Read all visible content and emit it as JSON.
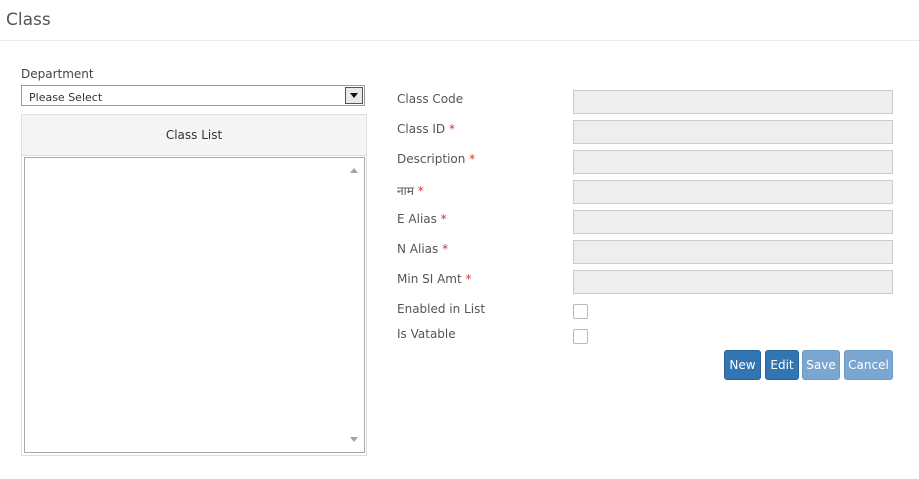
{
  "page": {
    "title": "Class"
  },
  "department": {
    "label": "Department",
    "selected": "Please Select"
  },
  "class_list": {
    "header": "Class List"
  },
  "form": {
    "fields": [
      {
        "label": "Class Code",
        "required": ""
      },
      {
        "label": "Class ID",
        "required": "*"
      },
      {
        "label": "Description",
        "required": "*"
      },
      {
        "label": "नाम",
        "required": "*"
      },
      {
        "label": "E Alias",
        "required": "*"
      },
      {
        "label": "N Alias",
        "required": "*"
      },
      {
        "label": "Min SI Amt",
        "required": "*"
      }
    ],
    "checks": [
      {
        "label": "Enabled in List"
      },
      {
        "label": "Is Vatable"
      }
    ]
  },
  "buttons": {
    "new": "New",
    "edit": "Edit",
    "save": "Save",
    "cancel": "Cancel"
  },
  "colors": {
    "primary": "#3175b3",
    "primary_disabled": "#7aa7d2",
    "required": "#d9302f"
  }
}
